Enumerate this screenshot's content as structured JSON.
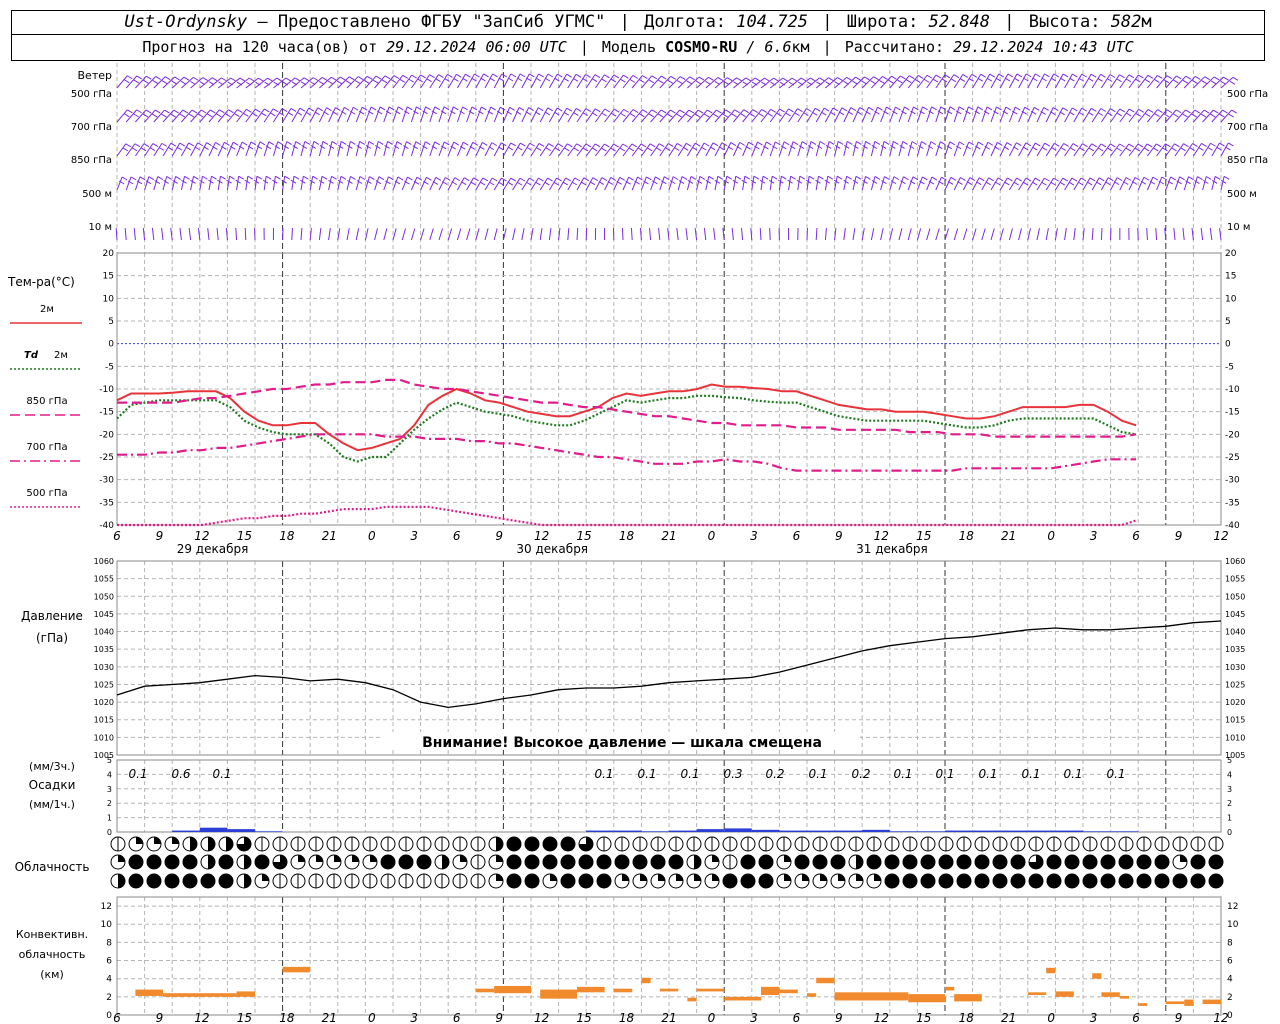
{
  "header": {
    "station": "Ust-Ordynsky",
    "provider": "— Предоставлено ФГБУ \"ЗапСиб УГМС\"",
    "lon_label": "Долгота:",
    "lon_value": "104.725",
    "lat_label": "Широта:",
    "lat_value": "52.848",
    "alt_label": "Высота:",
    "alt_value": "582",
    "alt_unit": "м",
    "forecast_label": "Прогноз на 120 часа(ов) от",
    "forecast_start": "29.12.2024 06:00 UTC",
    "model_label": "Модель",
    "model_name": "COSMO-RU",
    "model_res": "/ 6.6",
    "model_res_unit": "км",
    "calc_label": "Рассчитано:",
    "calc_time": "29.12.2024 10:43 UTC",
    "separator": "|"
  },
  "time_axis": {
    "hour_labels": [
      "6",
      "9",
      "12",
      "15",
      "18",
      "21",
      "0",
      "3",
      "6",
      "9",
      "12",
      "15",
      "18",
      "21",
      "0",
      "3",
      "6",
      "9",
      "12",
      "15",
      "18",
      "21",
      "0",
      "3",
      "6",
      "9",
      "12"
    ],
    "day_labels": [
      "29 декабря",
      "30 декабря",
      "31 декабря"
    ]
  },
  "wind": {
    "title": "Ветер",
    "levels": [
      "500 гПа",
      "700 гПа",
      "850 гПа",
      "500 м",
      "10 м"
    ],
    "color": "#7a2be0"
  },
  "temperature": {
    "title": "Тем-ра(°C)",
    "ticks": [
      20,
      15,
      10,
      5,
      0,
      -5,
      -10,
      -15,
      -20,
      -25,
      -30,
      -35,
      -40
    ],
    "legend": [
      {
        "label": "2м",
        "italic": false,
        "color": "#e8333a",
        "style": "solid"
      },
      {
        "label": "Td",
        "label2": "2м",
        "italic": true,
        "color": "#1e7a1e",
        "style": "dotted"
      },
      {
        "label": "850 гПа",
        "italic": false,
        "color": "#e01c8c",
        "style": "dashed"
      },
      {
        "label": "700 гПа",
        "italic": false,
        "color": "#e01c8c",
        "style": "dashdot"
      },
      {
        "label": "500 гПа",
        "italic": false,
        "color": "#e01c8c",
        "style": "dotted"
      }
    ]
  },
  "pressure": {
    "title": "Давление",
    "unit": "(гПа)",
    "ticks": [
      1060,
      1055,
      1050,
      1045,
      1040,
      1035,
      1030,
      1025,
      1020,
      1015,
      1010,
      1005
    ],
    "warning": "Внимание! Высокое давление — шкала смещена"
  },
  "precip": {
    "title_top": "(мм/3ч.)",
    "title_mid": "Осадки",
    "title_bot": "(мм/1ч.)",
    "ticks": [
      5,
      4,
      3,
      2,
      1,
      0
    ],
    "labels": [
      "0.1",
      "0.6",
      "0.1",
      "0.1",
      "0.1",
      "0.1",
      "0.3",
      "0.2",
      "0.1",
      "0.2",
      "0.1",
      "0.1",
      "0.1",
      "0.1",
      "0.1",
      "0.1"
    ]
  },
  "cloud": {
    "title": "Облачность"
  },
  "convective": {
    "title1": "Конвективн.",
    "title2": "облачность",
    "title3": "(км)",
    "ticks": [
      12,
      10,
      8,
      6,
      4,
      2,
      0
    ],
    "color": "#f08a2c"
  },
  "chart_data": [
    {
      "type": "line",
      "title": "Тем-ра(°C)",
      "x_hours_from_start": [
        0,
        3,
        6,
        9,
        12,
        15,
        18,
        21,
        24,
        27,
        30,
        33,
        36,
        39,
        42,
        45,
        48,
        51,
        54,
        57,
        60,
        63,
        66,
        69,
        72,
        75,
        78,
        81,
        84,
        87,
        90,
        93,
        96,
        99,
        102,
        105,
        108,
        111,
        114,
        117,
        120,
        123,
        126,
        129,
        132,
        135,
        138,
        141,
        144,
        147,
        150,
        153,
        156,
        159,
        162,
        165,
        168,
        171,
        174,
        177,
        180,
        183,
        186,
        189,
        192,
        195,
        198,
        201,
        204,
        207,
        210,
        213,
        216,
        219,
        222,
        225,
        228,
        231,
        234
      ],
      "ylim": [
        -40,
        20
      ],
      "series": [
        {
          "name": "2м",
          "values": [
            -12.5,
            -11,
            -11,
            -11,
            -10.8,
            -10.5,
            -10.5,
            -10.5,
            -12,
            -15,
            -17,
            -18,
            -18,
            -17.5,
            -17.5,
            -20,
            -22,
            -23.5,
            -23,
            -22,
            -21,
            -18,
            -13.5,
            -11.5,
            -10,
            -11,
            -12.5,
            -13,
            -14,
            -15,
            -15.5,
            -16,
            -16,
            -15,
            -14,
            -12,
            -11,
            -11.5,
            -11,
            -10.5,
            -10.5,
            -10,
            -9,
            -9.5,
            -9.5,
            -9.8,
            -10,
            -10.5,
            -10.5,
            -11.5,
            -12.5,
            -13.5,
            -14,
            -14.5,
            -14.5,
            -15,
            -15,
            -15,
            -15.5,
            -16,
            -16.5,
            -16.5,
            -16,
            -15,
            -14,
            -14,
            -14,
            -14,
            -13.5,
            -13.5,
            -15,
            -17,
            -18
          ]
        },
        {
          "name": "Td 2м",
          "values": [
            -16.5,
            -13.5,
            -13,
            -12.5,
            -12.5,
            -12.5,
            -12.5,
            -12.5,
            -14,
            -17,
            -18.5,
            -19.5,
            -20,
            -20,
            -20,
            -22,
            -25,
            -26,
            -25,
            -25,
            -22,
            -19,
            -16.5,
            -14.5,
            -13,
            -14,
            -15,
            -15.5,
            -16,
            -17,
            -17.5,
            -18,
            -18,
            -17,
            -15.5,
            -14,
            -12.5,
            -13,
            -12.5,
            -12,
            -12,
            -11.5,
            -11.5,
            -11.8,
            -12,
            -12.5,
            -12.8,
            -13,
            -13,
            -14,
            -15,
            -16,
            -16.5,
            -17,
            -17,
            -17,
            -17,
            -17,
            -17.5,
            -18,
            -18.5,
            -18.5,
            -18,
            -17,
            -16.5,
            -16.5,
            -16.5,
            -16.5,
            -16.5,
            -16.5,
            -18,
            -19.5,
            -20
          ]
        },
        {
          "name": "850 гПа",
          "values": [
            -13,
            -13,
            -13,
            -13,
            -13,
            -12.5,
            -12,
            -12,
            -11.5,
            -11,
            -10.5,
            -10,
            -10,
            -9.5,
            -9,
            -9,
            -8.5,
            -8.5,
            -8.5,
            -8,
            -8,
            -9,
            -9.5,
            -10,
            -10,
            -10.5,
            -11,
            -11.5,
            -12,
            -12.5,
            -13,
            -13,
            -13.5,
            -14,
            -14,
            -14.5,
            -15,
            -15.5,
            -16,
            -16,
            -16.5,
            -17,
            -17.5,
            -17.5,
            -18,
            -18,
            -18,
            -18,
            -18.5,
            -18.5,
            -18.5,
            -19,
            -19,
            -19,
            -19,
            -19,
            -19.5,
            -19.5,
            -19.5,
            -20,
            -20,
            -20,
            -20.5,
            -20.5,
            -20.5,
            -20.5,
            -20.5,
            -20.5,
            -20.5,
            -20.5,
            -20.5,
            -20.5,
            -20
          ]
        },
        {
          "name": "700 гПа",
          "values": [
            -24.5,
            -24.5,
            -24.5,
            -24,
            -24,
            -23.5,
            -23.5,
            -23,
            -23,
            -22.5,
            -22,
            -21.5,
            -21,
            -20.5,
            -20,
            -20,
            -20,
            -20,
            -20,
            -20.5,
            -20.5,
            -20.5,
            -21,
            -21,
            -21,
            -21.5,
            -21.5,
            -22,
            -22,
            -22.5,
            -23,
            -23.5,
            -24,
            -24.5,
            -25,
            -25,
            -25.5,
            -26,
            -26.5,
            -26.5,
            -26.5,
            -26,
            -26,
            -25.5,
            -26,
            -26,
            -26.5,
            -27.5,
            -28,
            -28,
            -28,
            -28,
            -28,
            -28,
            -28,
            -28,
            -28,
            -28,
            -28,
            -28,
            -27.5,
            -27.5,
            -27.5,
            -27.5,
            -27.5,
            -27.5,
            -27.5,
            -27,
            -26.5,
            -26,
            -25.5,
            -25.5,
            -25.5
          ]
        },
        {
          "name": "500 гПа",
          "values": [
            -44,
            -43,
            -42,
            -41.5,
            -40,
            -40,
            -40,
            -39.5,
            -39,
            -38.5,
            -38.5,
            -38,
            -38,
            -37.5,
            -37.5,
            -37,
            -36.5,
            -36.5,
            -36.5,
            -36,
            -36,
            -36,
            -36,
            -36.5,
            -37,
            -37.5,
            -38,
            -38.5,
            -39,
            -39.5,
            -40,
            -40.5,
            -41,
            -41.5,
            -42,
            -42,
            -42.5,
            -43,
            -43,
            -43,
            -43,
            -43,
            -43,
            -43,
            -43,
            -43,
            -43,
            -43,
            -43,
            -43,
            -43,
            -43,
            -43,
            -43,
            -43,
            -43,
            -43,
            -43,
            -43,
            -43,
            -43,
            -43,
            -43,
            -43,
            -43,
            -43,
            -43,
            -43,
            -43,
            -43,
            -42,
            -40,
            -39
          ]
        }
      ]
    },
    {
      "type": "line",
      "title": "Давление",
      "ylabel": "(гПа)",
      "ylim": [
        1005,
        1060
      ],
      "x_hours_from_start": [
        0,
        3,
        6,
        9,
        12,
        15,
        18,
        21,
        24,
        27,
        30,
        33,
        36,
        39,
        42,
        45,
        48,
        51,
        54,
        57,
        60,
        63,
        66,
        69,
        72,
        75,
        78,
        81,
        84,
        87,
        90,
        93,
        96,
        99,
        102,
        105,
        108,
        111,
        114,
        117,
        120
      ],
      "series": [
        {
          "name": "Давление",
          "values": [
            1022,
            1024.5,
            1025,
            1025.5,
            1026.5,
            1027.5,
            1027,
            1026,
            1026.5,
            1025.5,
            1023.5,
            1020,
            1018.5,
            1019.5,
            1021,
            1022,
            1023.5,
            1024,
            1024,
            1024.5,
            1025.5,
            1026,
            1026.5,
            1027,
            1028.5,
            1030.5,
            1032.5,
            1034.5,
            1036,
            1037,
            1038,
            1038.5,
            1039.5,
            1040.5,
            1041,
            1040.5,
            1040.5,
            1041,
            1041.5,
            1042.5,
            1043
          ]
        }
      ]
    },
    {
      "type": "bar",
      "title": "Осадки",
      "ylim": [
        0,
        5
      ],
      "x_hours_from_start": [
        0,
        3,
        6,
        9,
        12,
        15,
        18,
        21,
        24,
        27,
        30,
        33,
        36,
        39,
        42,
        45,
        48,
        51,
        54,
        57,
        60,
        63,
        66,
        69,
        72,
        75,
        78,
        81,
        84,
        87,
        90,
        93,
        96,
        99,
        102,
        105,
        108,
        111,
        114,
        117
      ],
      "values": [
        0,
        0,
        0.1,
        0.3,
        0.2,
        0.05,
        0,
        0,
        0,
        0,
        0,
        0,
        0,
        0,
        0,
        0,
        0,
        0.1,
        0.1,
        0.05,
        0.1,
        0.2,
        0.25,
        0.15,
        0.1,
        0.1,
        0.1,
        0.15,
        0.05,
        0.05,
        0.1,
        0.1,
        0.1,
        0.1,
        0.1,
        0.05,
        0.05,
        0,
        0,
        0
      ]
    },
    {
      "type": "bar",
      "title": "Конвективн. облачность",
      "ylabel": "(км)",
      "ylim": [
        0,
        13
      ],
      "segments": [
        {
          "h0": 2,
          "h1": 5,
          "bottom": 2.1,
          "top": 2.8
        },
        {
          "h0": 5,
          "h1": 13,
          "bottom": 2.0,
          "top": 2.4
        },
        {
          "h0": 13,
          "h1": 15,
          "bottom": 2.0,
          "top": 2.6
        },
        {
          "h0": 18,
          "h1": 21,
          "bottom": 4.7,
          "top": 5.3
        },
        {
          "h0": 39,
          "h1": 41,
          "bottom": 2.5,
          "top": 2.9
        },
        {
          "h0": 41,
          "h1": 45,
          "bottom": 2.4,
          "top": 3.2
        },
        {
          "h0": 46,
          "h1": 50,
          "bottom": 1.8,
          "top": 2.8
        },
        {
          "h0": 50,
          "h1": 53,
          "bottom": 2.5,
          "top": 3.1
        },
        {
          "h0": 54,
          "h1": 56,
          "bottom": 2.5,
          "top": 2.9
        },
        {
          "h0": 57,
          "h1": 58,
          "bottom": 3.5,
          "top": 4.1
        },
        {
          "h0": 59,
          "h1": 61,
          "bottom": 2.6,
          "top": 2.9
        },
        {
          "h0": 62,
          "h1": 63,
          "bottom": 1.5,
          "top": 1.9
        },
        {
          "h0": 63,
          "h1": 66,
          "bottom": 2.6,
          "top": 2.9
        },
        {
          "h0": 66,
          "h1": 70,
          "bottom": 1.6,
          "top": 2.0
        },
        {
          "h0": 70,
          "h1": 72,
          "bottom": 2.2,
          "top": 3.1
        },
        {
          "h0": 72,
          "h1": 74,
          "bottom": 2.4,
          "top": 2.8
        },
        {
          "h0": 75,
          "h1": 76,
          "bottom": 2.0,
          "top": 2.4
        },
        {
          "h0": 76,
          "h1": 78,
          "bottom": 3.5,
          "top": 4.1
        },
        {
          "h0": 78,
          "h1": 86,
          "bottom": 1.6,
          "top": 2.5
        },
        {
          "h0": 86,
          "h1": 90,
          "bottom": 1.4,
          "top": 2.3
        },
        {
          "h0": 90,
          "h1": 91,
          "bottom": 2.7,
          "top": 3.1
        },
        {
          "h0": 91,
          "h1": 94,
          "bottom": 1.5,
          "top": 2.3
        },
        {
          "h0": 99,
          "h1": 101,
          "bottom": 2.2,
          "top": 2.5
        },
        {
          "h0": 101,
          "h1": 102,
          "bottom": 4.6,
          "top": 5.2
        },
        {
          "h0": 102,
          "h1": 104,
          "bottom": 2.0,
          "top": 2.6
        },
        {
          "h0": 106,
          "h1": 107,
          "bottom": 4.0,
          "top": 4.6
        },
        {
          "h0": 107,
          "h1": 109,
          "bottom": 2.0,
          "top": 2.5
        },
        {
          "h0": 109,
          "h1": 110,
          "bottom": 1.8,
          "top": 2.1
        },
        {
          "h0": 111,
          "h1": 112,
          "bottom": 1.0,
          "top": 1.3
        },
        {
          "h0": 114,
          "h1": 116,
          "bottom": 1.2,
          "top": 1.5
        },
        {
          "h0": 116,
          "h1": 117,
          "bottom": 1.0,
          "top": 1.7
        },
        {
          "h0": 118,
          "h1": 120,
          "bottom": 1.2,
          "top": 1.7
        }
      ]
    }
  ]
}
